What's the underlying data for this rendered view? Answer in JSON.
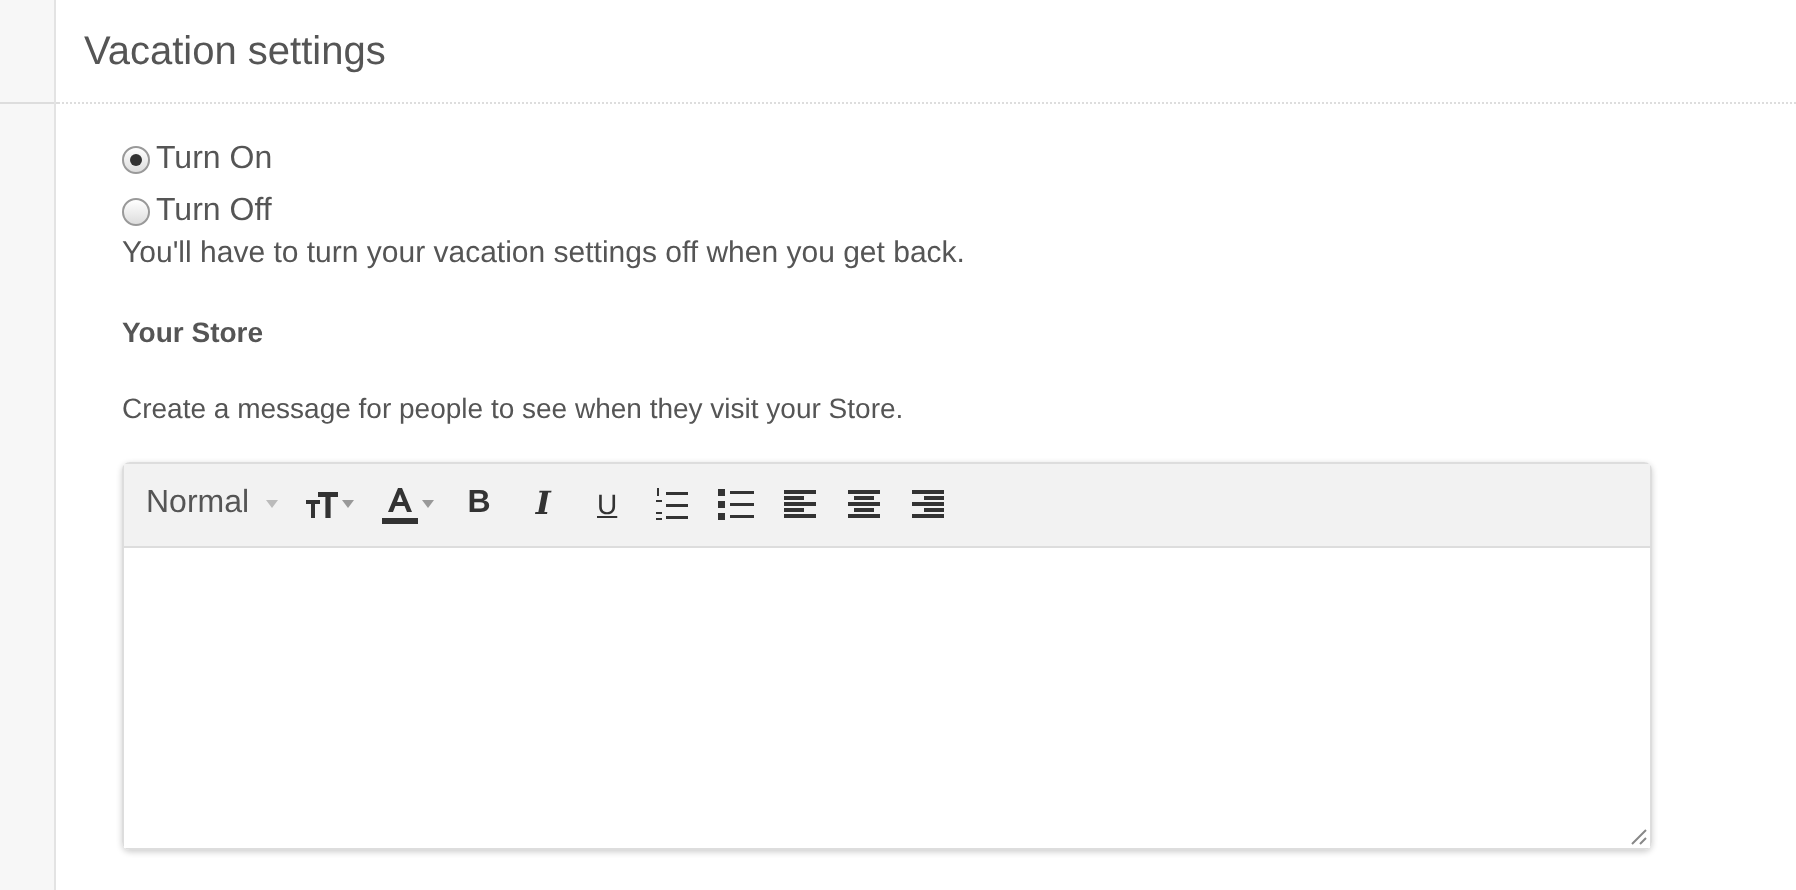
{
  "title": "Vacation settings",
  "options": [
    {
      "label": "Turn On",
      "selected": true
    },
    {
      "label": "Turn Off",
      "selected": false
    }
  ],
  "note": "You'll have to turn your vacation settings off when you get back.",
  "section_heading": "Your Store",
  "description": "Create a message for people to see when they visit your Store.",
  "editor": {
    "format": "Normal",
    "toolbar": [
      {
        "kind": "text-size"
      },
      {
        "kind": "font-color"
      },
      {
        "kind": "glyph",
        "label": "B"
      },
      {
        "kind": "glyph",
        "label": "I"
      },
      {
        "kind": "glyph",
        "label": "U"
      },
      {
        "kind": "ordered-list"
      },
      {
        "kind": "bullet-list"
      },
      {
        "kind": "align-left"
      },
      {
        "kind": "align-center"
      },
      {
        "kind": "align-right"
      }
    ]
  }
}
